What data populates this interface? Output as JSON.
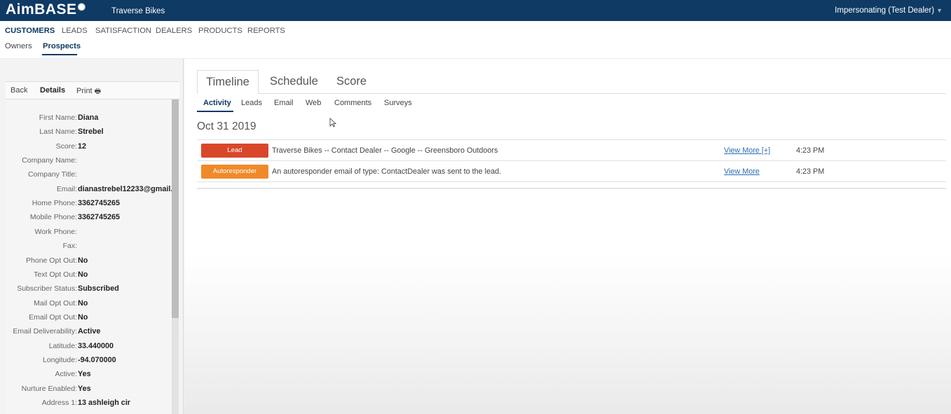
{
  "header": {
    "logo": "AimBASE",
    "dealer": "Traverse Bikes",
    "impersonating": "Impersonating (Test Dealer)"
  },
  "nav": {
    "tabs": [
      {
        "label": "CUSTOMERS",
        "active": true
      },
      {
        "label": "LEADS"
      },
      {
        "label": "SATISFACTION"
      },
      {
        "label": "DEALERS"
      },
      {
        "label": "PRODUCTS"
      },
      {
        "label": "REPORTS"
      }
    ],
    "subtabs": [
      {
        "label": "Owners"
      },
      {
        "label": "Prospects",
        "active": true
      }
    ]
  },
  "left_panel": {
    "tabs": {
      "back": "Back",
      "details": "Details",
      "print": "Print"
    },
    "fields": [
      {
        "label": "First Name:",
        "value": "Diana"
      },
      {
        "label": "Last Name:",
        "value": "Strebel"
      },
      {
        "label": "Score:",
        "value": "12"
      },
      {
        "label": "Company Name:",
        "value": ""
      },
      {
        "label": "Company Title:",
        "value": ""
      },
      {
        "label": "Email:",
        "value": "dianastrebel12233@gmail."
      },
      {
        "label": "Home Phone:",
        "value": "3362745265"
      },
      {
        "label": "Mobile Phone:",
        "value": "3362745265"
      },
      {
        "label": "Work Phone:",
        "value": ""
      },
      {
        "label": "Fax:",
        "value": ""
      },
      {
        "label": "Phone Opt Out:",
        "value": "No"
      },
      {
        "label": "Text Opt Out:",
        "value": "No"
      },
      {
        "label": "Subscriber Status:",
        "value": "Subscribed"
      },
      {
        "label": "Mail Opt Out:",
        "value": "No"
      },
      {
        "label": "Email Opt Out:",
        "value": "No"
      },
      {
        "label": "Email Deliverability:",
        "value": "Active"
      },
      {
        "label": "Latitude:",
        "value": "33.440000"
      },
      {
        "label": "Longitude:",
        "value": "-94.070000"
      },
      {
        "label": "Active:",
        "value": "Yes"
      },
      {
        "label": "Nurture Enabled:",
        "value": "Yes"
      },
      {
        "label": "Address 1:",
        "value": "13 ashleigh cir"
      }
    ]
  },
  "main": {
    "tabs": [
      {
        "label": "Timeline",
        "active": true
      },
      {
        "label": "Schedule"
      },
      {
        "label": "Score"
      }
    ],
    "subtabs": [
      {
        "label": "Activity",
        "active": true
      },
      {
        "label": "Leads"
      },
      {
        "label": "Email"
      },
      {
        "label": "Web"
      },
      {
        "label": "Comments"
      },
      {
        "label": "Surveys"
      }
    ],
    "date": "Oct 31 2019",
    "activities": [
      {
        "badge": "Lead",
        "badge_color": "#d9472b",
        "description": "Traverse Bikes -- Contact Dealer -- Google -- Greensboro Outdoors",
        "link": "View More [+]",
        "time": "4:23 PM"
      },
      {
        "badge": "Autoresponder",
        "badge_color": "#f0892a",
        "description": "An autoresponder email of type: ContactDealer was sent to the lead.",
        "link": "View More",
        "time": "4:23 PM"
      }
    ]
  },
  "colors": {
    "brand": "#0e3a63",
    "link": "#2a6fb5"
  }
}
